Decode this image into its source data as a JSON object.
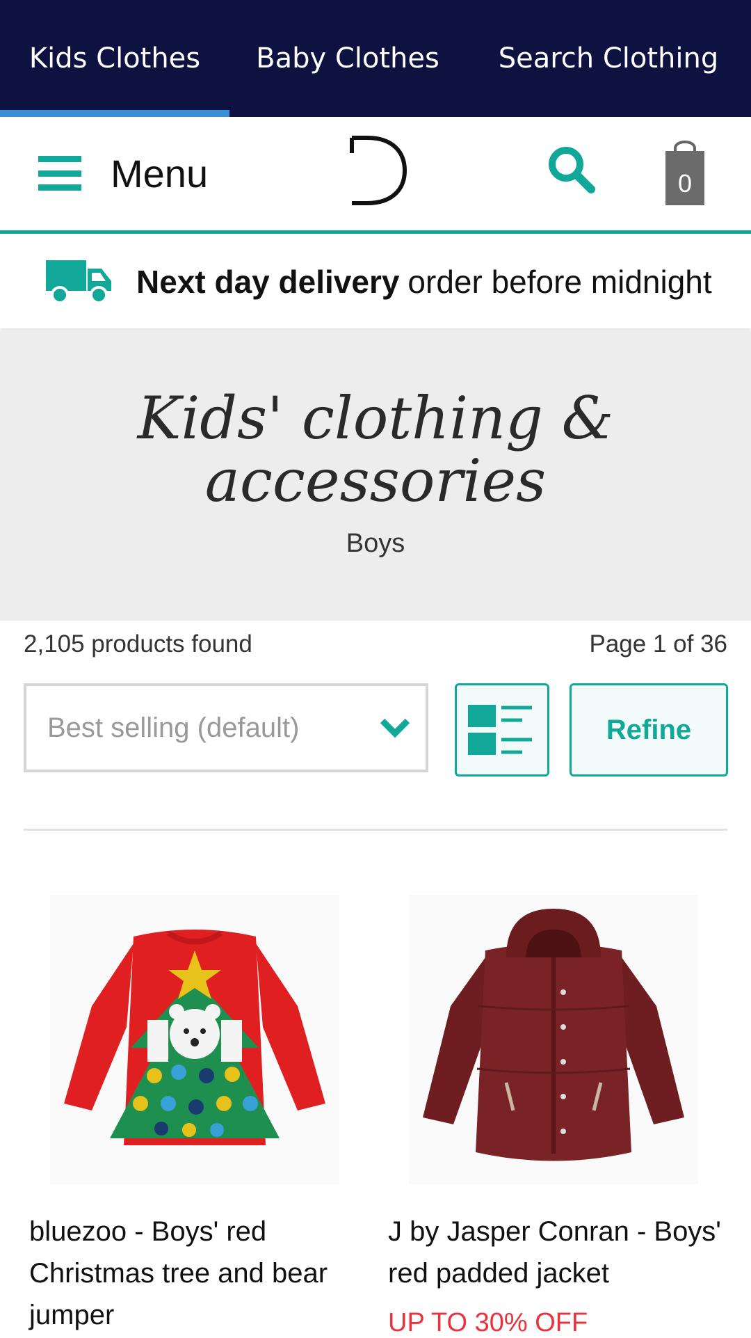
{
  "tabs": [
    {
      "label": "Kids Clothes",
      "active": true
    },
    {
      "label": "Baby Clothes",
      "active": false
    },
    {
      "label": "Search Clothing",
      "active": false
    }
  ],
  "header": {
    "menu_label": "Menu",
    "logo_text": "D",
    "bag_count": "0"
  },
  "delivery": {
    "bold": "Next day delivery",
    "rest": "order before midnight"
  },
  "hero": {
    "title_line1": "Kids' clothing &",
    "title_line2": "accessories",
    "subtitle": "Boys"
  },
  "results": {
    "count": "2,105 products found",
    "page": "Page 1 of 36"
  },
  "sort": {
    "value": "Best selling (default)"
  },
  "refine_label": "Refine",
  "products": [
    {
      "name": "bluezoo - Boys' red Christmas tree and bear jumper",
      "image": "red-christmas-jumper"
    },
    {
      "name": "J by Jasper Conran - Boys' red padded jacket",
      "promo": "UP TO 30% OFF",
      "image": "red-padded-jacket"
    }
  ],
  "colors": {
    "navy": "#0d1240",
    "teal": "#11a89a",
    "tab_underline": "#3b8fd6",
    "promo_red": "#e8333c"
  }
}
